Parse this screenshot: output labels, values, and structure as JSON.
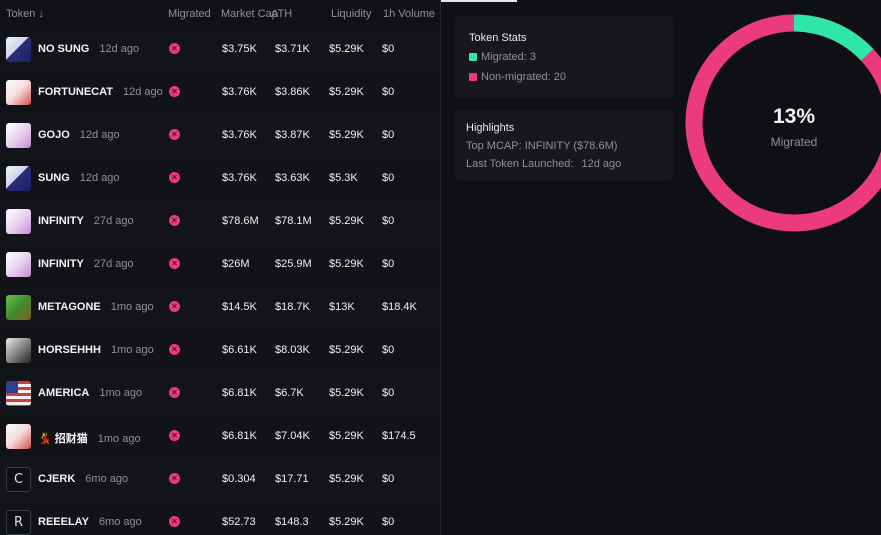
{
  "table": {
    "columns": [
      "Token",
      "Migrated",
      "Market Cap",
      "ATH",
      "Liquidity",
      "1h Volume"
    ],
    "sort_icon": "arrow-down",
    "rows": [
      {
        "name": "NO SUNG",
        "age": "12d ago",
        "avatar": "anime",
        "mcap": "$3.75K",
        "ath": "$3.71K",
        "liq": "$5.29K",
        "vol": "$0"
      },
      {
        "name": "FORTUNECAT",
        "age": "12d ago",
        "avatar": "cat",
        "mcap": "$3.76K",
        "ath": "$3.86K",
        "liq": "$5.29K",
        "vol": "$0"
      },
      {
        "name": "GOJO",
        "age": "12d ago",
        "avatar": "pink",
        "mcap": "$3.76K",
        "ath": "$3.87K",
        "liq": "$5.29K",
        "vol": "$0"
      },
      {
        "name": "SUNG",
        "age": "12d ago",
        "avatar": "anime",
        "mcap": "$3.76K",
        "ath": "$3.63K",
        "liq": "$5.3K",
        "vol": "$0"
      },
      {
        "name": "INFINITY",
        "age": "27d ago",
        "avatar": "pink",
        "mcap": "$78.6M",
        "ath": "$78.1M",
        "liq": "$5.29K",
        "vol": "$0"
      },
      {
        "name": "INFINITY",
        "age": "27d ago",
        "avatar": "pink",
        "mcap": "$26M",
        "ath": "$25.9M",
        "liq": "$5.29K",
        "vol": "$0"
      },
      {
        "name": "METAGONE",
        "age": "1mo ago",
        "avatar": "pixel",
        "mcap": "$14.5K",
        "ath": "$18.7K",
        "liq": "$13K",
        "vol": "$18.4K"
      },
      {
        "name": "HORSEHHH",
        "age": "1mo ago",
        "avatar": "horse",
        "mcap": "$6.61K",
        "ath": "$8.03K",
        "liq": "$5.29K",
        "vol": "$0"
      },
      {
        "name": "AMERICA",
        "age": "1mo ago",
        "avatar": "flag",
        "mcap": "$6.81K",
        "ath": "$6.7K",
        "liq": "$5.29K",
        "vol": "$0"
      },
      {
        "name": "💃 招财猫",
        "age": "1mo ago",
        "avatar": "cat",
        "mcap": "$6.81K",
        "ath": "$7.04K",
        "liq": "$5.29K",
        "vol": "$174.5"
      },
      {
        "name": "CJERK",
        "age": "6mo ago",
        "avatar": "letter",
        "letter": "C",
        "mcap": "$0.304",
        "ath": "$17.71",
        "liq": "$5.29K",
        "vol": "$0"
      },
      {
        "name": "REEELAY",
        "age": "6mo ago",
        "avatar": "letter",
        "letter": "R",
        "mcap": "$52.73",
        "ath": "$148.3",
        "liq": "$5.29K",
        "vol": "$0"
      }
    ]
  },
  "stats": {
    "title": "Token Stats",
    "migrated_label": "Migrated:",
    "migrated_value": "3",
    "non_migrated_label": "Non-migrated:",
    "non_migrated_value": "20"
  },
  "highlights": {
    "title": "Highlights",
    "top_mcap_label": "Top MCAP:",
    "top_mcap_value": "INFINITY ($78.6M)",
    "last_launch_label": "Last Token Launched:",
    "last_launch_value": "12d ago"
  },
  "donut": {
    "percent_label": "13%",
    "caption": "Migrated",
    "migrated": 3,
    "non_migrated": 20
  },
  "colors": {
    "migrated": "#2ee6a8",
    "non_migrated": "#ec3b7d"
  }
}
